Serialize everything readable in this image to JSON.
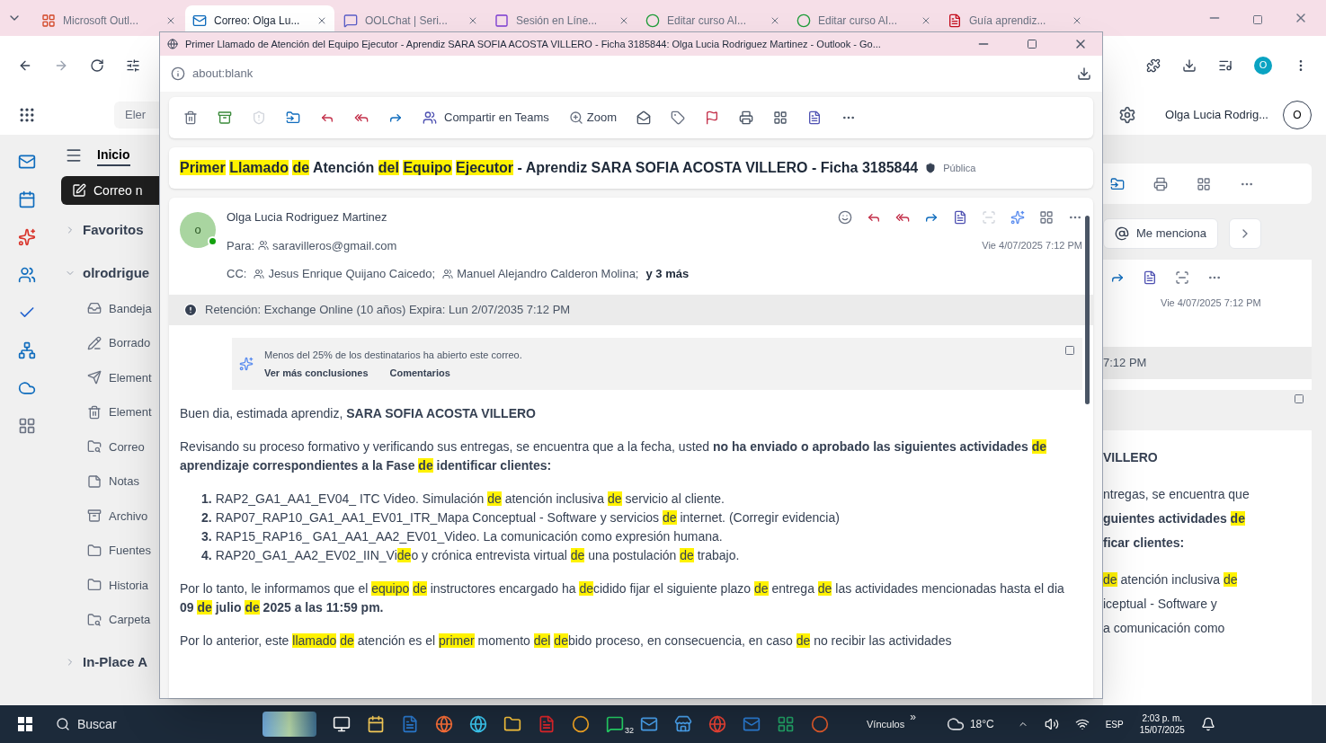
{
  "browser": {
    "tabs": [
      {
        "label": "Microsoft Outl...",
        "selected": false
      },
      {
        "label": "Correo: Olga Lu...",
        "selected": true
      },
      {
        "label": "OOLChat | Seri...",
        "selected": false
      },
      {
        "label": "Sesión en Líne...",
        "selected": false
      },
      {
        "label": "Editar curso AI...",
        "selected": false
      },
      {
        "label": "Editar curso AI...",
        "selected": false
      },
      {
        "label": "Guía aprendiz...",
        "selected": false
      }
    ],
    "profile_initial": "O"
  },
  "outlook": {
    "search_placeholder": "Eler",
    "user_name": "Olga Lucia Rodrig...",
    "avatar_initial": "O",
    "ribbon_tab": "Inicio",
    "new_mail_button": "Correo n",
    "groups": [
      {
        "label": "Favoritos",
        "expanded": false
      },
      {
        "label": "olrodrigue",
        "expanded": true,
        "children": [
          {
            "kind": "inbox",
            "label": "Bandeja"
          },
          {
            "kind": "draft",
            "label": "Borrado"
          },
          {
            "kind": "sent",
            "label": "Element"
          },
          {
            "kind": "trash",
            "label": "Element"
          },
          {
            "kind": "junk",
            "label": "Correo"
          },
          {
            "kind": "notes",
            "label": "Notas"
          },
          {
            "kind": "archive",
            "label": "Archivo"
          },
          {
            "kind": "folder",
            "label": "Fuentes"
          },
          {
            "kind": "folder",
            "label": "Historia"
          },
          {
            "kind": "search",
            "label": "Carpeta"
          }
        ]
      },
      {
        "label": "In-Place A",
        "expanded": false
      }
    ],
    "reading_pane": {
      "filter": "Me menciona",
      "date": "Vie 4/07/2025 7:12 PM",
      "retention_tail": "7:12 PM",
      "lines": [
        [
          {
            "kind": "bold",
            "text": "VILLERO"
          }
        ],
        [
          {
            "kind": "plain",
            "text": "ntregas, se encuentra que"
          }
        ],
        [
          {
            "kind": "bold",
            "text": "guientes actividades "
          },
          {
            "kind": "bold_mark",
            "text": "de"
          }
        ],
        [
          {
            "kind": "bold",
            "text": "ficar clientes:"
          }
        ],
        [
          {
            "kind": "mark",
            "text": "de"
          },
          {
            "kind": "plain",
            "text": " atención inclusiva "
          },
          {
            "kind": "mark",
            "text": "de"
          }
        ],
        [
          {
            "kind": "plain",
            "text": "iceptual - Software y"
          }
        ],
        [
          {
            "kind": "plain",
            "text": "a comunicación como"
          }
        ]
      ]
    }
  },
  "popup": {
    "title": "Primer Llamado de Atención del Equipo Ejecutor - Aprendiz SARA SOFIA ACOSTA VILLERO - Ficha 3185844: Olga Lucia Rodriguez Martinez - Outlook - Go...",
    "address": "about:blank",
    "toolbar": {
      "teams": "Compartir en Teams",
      "zoom": "Zoom"
    },
    "subject": [
      {
        "kind": "mark_sp",
        "text": "Primer"
      },
      {
        "kind": "mark_sp",
        "text": "Llamado"
      },
      {
        "kind": "mark",
        "text": "de"
      },
      {
        "kind": "plain",
        "text": " Atención "
      },
      {
        "kind": "mark_sp",
        "text": "del"
      },
      {
        "kind": "mark_sp",
        "text": "Equipo"
      },
      {
        "kind": "mark",
        "text": "Ejecutor"
      },
      {
        "kind": "plain",
        "text": " - Aprendiz SARA SOFIA ACOSTA VILLERO - Ficha 3185844"
      }
    ],
    "sensitivity": "Pública",
    "message": {
      "avatar_initial": "o",
      "online": true,
      "sender": "Olga Lucia Rodriguez Martinez",
      "to_label": "Para:",
      "to": [
        "saravilleros@gmail.com"
      ],
      "date": "Vie 4/07/2025 7:12 PM",
      "cc_label": "CC:",
      "cc": [
        "Jesus Enrique Quijano Caicedo;",
        "Manuel Alejandro Calderon Molina;"
      ],
      "cc_more": "y 3 más"
    },
    "retention": "Retención: Exchange Online (10 años) Expira: Lun 2/07/2035 7:12 PM",
    "insight": {
      "text": "Menos del 25% de los destinatarios ha abierto este correo.",
      "links": [
        "Ver más conclusiones",
        "Comentarios"
      ]
    },
    "body": [
      {
        "kind": "paragraph",
        "segments": [
          {
            "kind": "plain",
            "text": "Buen dia, estimada aprendiz,  "
          },
          {
            "kind": "bold",
            "text": "SARA SOFIA ACOSTA VILLERO"
          }
        ]
      },
      {
        "kind": "paragraph",
        "segments": [
          {
            "kind": "plain",
            "text": "Revisando su proceso formativo y verificando sus entregas, se encuentra que a la fecha,  usted "
          },
          {
            "kind": "bold",
            "text": "no ha enviado o aprobado las siguientes actividades "
          },
          {
            "kind": "bold_mark",
            "text": "de"
          },
          {
            "kind": "bold",
            "text": " aprendizaje correspondientes a la Fase "
          },
          {
            "kind": "bold_mark",
            "text": "de"
          },
          {
            "kind": "bold",
            "text": " identificar clientes:"
          }
        ]
      },
      {
        "kind": "list",
        "items": [
          {
            "number": "1.",
            "segments": [
              {
                "kind": "plain",
                "text": "RAP2_GA1_AA1_EV04_ ITC Video. Simulación "
              },
              {
                "kind": "mark",
                "text": "de"
              },
              {
                "kind": "plain",
                "text": " atención inclusiva "
              },
              {
                "kind": "mark",
                "text": "de"
              },
              {
                "kind": "plain",
                "text": " servicio al cliente."
              }
            ]
          },
          {
            "number": "2.",
            "segments": [
              {
                "kind": "plain",
                "text": "RAP07_RAP10_GA1_AA1_EV01_ITR_Mapa Conceptual - Software y servicios "
              },
              {
                "kind": "mark",
                "text": "de"
              },
              {
                "kind": "plain",
                "text": " internet. (Corregir evidencia)"
              }
            ]
          },
          {
            "number": "3.",
            "segments": [
              {
                "kind": "plain",
                "text": "RAP15_RAP16_ GA1_AA1_AA2_EV01_Video. La comunicación como expresión humana."
              }
            ]
          },
          {
            "number": "4.",
            "segments": [
              {
                "kind": "plain",
                "text": "RAP20_GA1_AA2_EV02_IIN_Vi"
              },
              {
                "kind": "mark",
                "text": "de"
              },
              {
                "kind": "plain",
                "text": "o y crónica entrevista virtual "
              },
              {
                "kind": "mark",
                "text": "de"
              },
              {
                "kind": "plain",
                "text": " una postulación "
              },
              {
                "kind": "mark",
                "text": "de"
              },
              {
                "kind": "plain",
                "text": " trabajo."
              }
            ]
          }
        ]
      },
      {
        "kind": "paragraph",
        "segments": [
          {
            "kind": "plain",
            "text": "Por lo tanto, le informamos que el "
          },
          {
            "kind": "mark_sp",
            "text": "equipo"
          },
          {
            "kind": "mark",
            "text": "de"
          },
          {
            "kind": "plain",
            "text": " instructores encargado ha "
          },
          {
            "kind": "mark",
            "text": "de"
          },
          {
            "kind": "plain",
            "text": "cidido fijar el siguiente  plazo "
          },
          {
            "kind": "mark",
            "text": "de"
          },
          {
            "kind": "plain",
            "text": " entrega "
          },
          {
            "kind": "mark",
            "text": "de"
          },
          {
            "kind": "plain",
            "text": " las actividades mencionadas hasta el dia "
          },
          {
            "kind": "bold",
            "text": "09 "
          },
          {
            "kind": "bold_mark",
            "text": "de"
          },
          {
            "kind": "bold",
            "text": " julio "
          },
          {
            "kind": "bold_mark",
            "text": "de"
          },
          {
            "kind": "bold",
            "text": " 2025 a las 11:59 pm."
          }
        ]
      },
      {
        "kind": "paragraph",
        "segments": [
          {
            "kind": "plain",
            "text": "Por lo anterior, este "
          },
          {
            "kind": "mark_sp",
            "text": "llamado"
          },
          {
            "kind": "mark",
            "text": "de"
          },
          {
            "kind": "plain",
            "text": " atención es el "
          },
          {
            "kind": "mark",
            "text": "primer"
          },
          {
            "kind": "plain",
            "text": " momento "
          },
          {
            "kind": "mark_sp",
            "text": "del"
          },
          {
            "kind": "mark",
            "text": "de"
          },
          {
            "kind": "plain",
            "text": "bido proceso, en consecuencia, en caso "
          },
          {
            "kind": "mark",
            "text": "de"
          },
          {
            "kind": "plain",
            "text": " no recibir las actividades"
          }
        ]
      }
    ]
  },
  "taskbar": {
    "search": "Buscar",
    "links": "Vínculos",
    "links_more": "»",
    "weather": "18°C",
    "language": "ESP",
    "time": "2:03 p. m.",
    "date": "15/07/2025",
    "chat_badge": "32"
  }
}
